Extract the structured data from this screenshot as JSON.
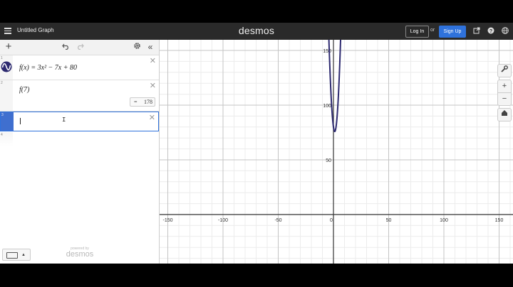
{
  "header": {
    "graph_title": "Untitled Graph",
    "logo": "desmos",
    "login_label": "Log In",
    "or_label": "or",
    "signup_label": "Sign Up",
    "icons": [
      "hamburger-icon",
      "share-icon",
      "help-icon",
      "globe-icon"
    ],
    "signup_color": "#2f72dc"
  },
  "expressions": [
    {
      "index": "1",
      "latex_display": "f(x) = 3x² − 7x + 80",
      "color": "#2d2a70"
    },
    {
      "index": "2",
      "latex_display": "f(7)",
      "evaluation_eq": "=",
      "evaluation_value": "178"
    },
    {
      "index": "3",
      "latex_display": ""
    },
    {
      "index": "4",
      "latex_display": ""
    }
  ],
  "panel": {
    "powered_by": "powered by",
    "powered_logo": "desmos"
  },
  "graph": {
    "x_ticks": [
      "-150",
      "-100",
      "-50",
      "0",
      "50",
      "100",
      "150"
    ],
    "y_ticks": [
      "50",
      "100",
      "150"
    ],
    "curve_color": "#2d2a70",
    "function": "3x^2 - 7x + 80"
  }
}
